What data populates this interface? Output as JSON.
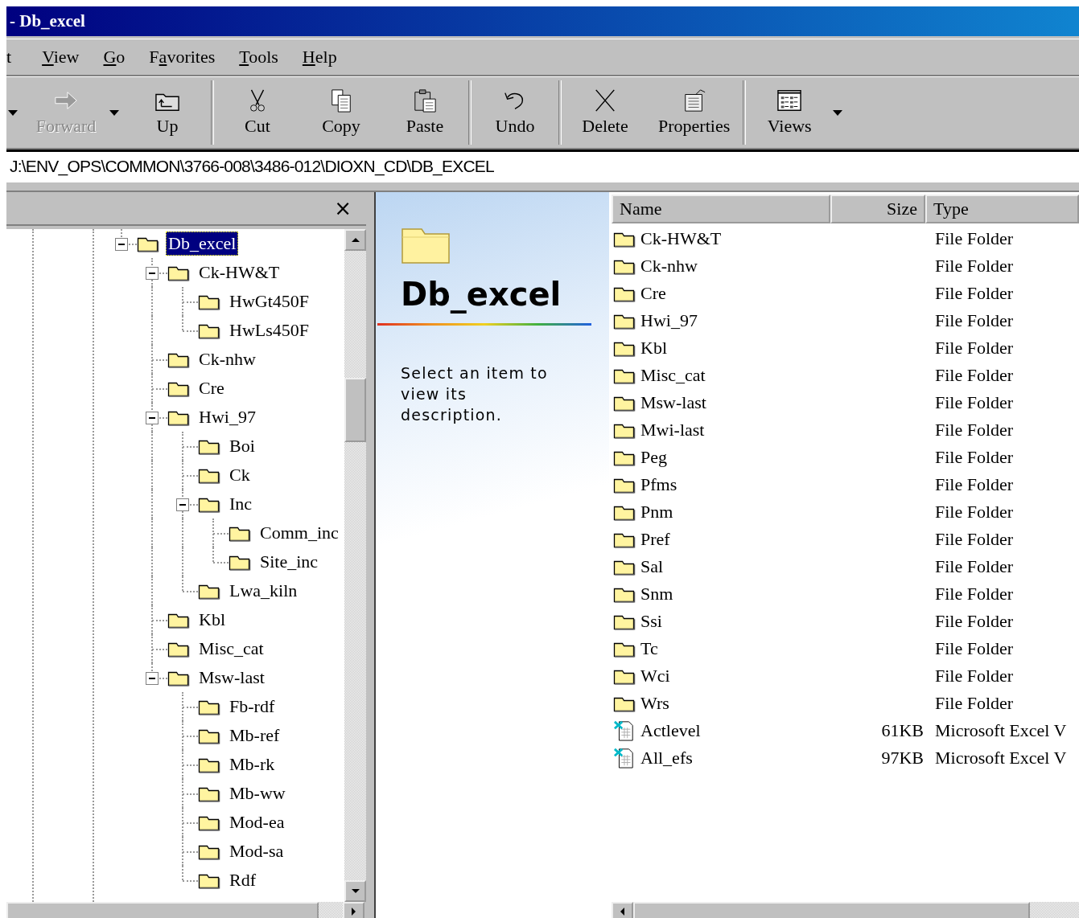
{
  "window": {
    "title": "- Db_excel"
  },
  "menu": [
    {
      "tail": "t"
    },
    {
      "key": "V",
      "tail": "iew"
    },
    {
      "key": "G",
      "tail": "o"
    },
    {
      "lead": "F",
      "key": "a",
      "tail": "vorites"
    },
    {
      "key": "T",
      "tail": "ools"
    },
    {
      "key": "H",
      "tail": "elp"
    }
  ],
  "toolbar": {
    "groups": [
      {
        "items": [
          {
            "kind": "arrow"
          },
          {
            "kind": "button",
            "label": "Forward",
            "disabled": true
          },
          {
            "kind": "arrow"
          },
          {
            "kind": "button",
            "label": "Up",
            "disabled": false
          }
        ]
      },
      {
        "items": [
          {
            "kind": "button",
            "label": "Cut",
            "disabled": false
          },
          {
            "kind": "button",
            "label": "Copy",
            "disabled": false
          },
          {
            "kind": "button",
            "label": "Paste",
            "disabled": false
          }
        ]
      },
      {
        "items": [
          {
            "kind": "button",
            "label": "Undo",
            "disabled": false
          }
        ]
      },
      {
        "items": [
          {
            "kind": "button",
            "label": "Delete",
            "disabled": false
          },
          {
            "kind": "button",
            "label": "Properties",
            "disabled": false
          }
        ]
      },
      {
        "items": [
          {
            "kind": "button",
            "label": "Views",
            "disabled": false
          },
          {
            "kind": "arrow"
          }
        ]
      }
    ]
  },
  "address": "J:\\ENV_OPS\\COMMON\\3766-008\\3486-012\\DIOXN_CD\\DB_EXCEL",
  "tree": {
    "close": "×",
    "nodes": [
      {
        "label": "Db_excel",
        "selected": true,
        "expanded": true,
        "children": [
          {
            "label": "Ck-HW&T",
            "selected": false,
            "expanded": true,
            "children": [
              {
                "label": "HwGt450F",
                "selected": false
              },
              {
                "label": "HwLs450F",
                "selected": false
              }
            ]
          },
          {
            "label": "Ck-nhw",
            "selected": false
          },
          {
            "label": "Cre",
            "selected": false
          },
          {
            "label": "Hwi_97",
            "selected": false,
            "expanded": true,
            "children": [
              {
                "label": "Boi",
                "selected": false
              },
              {
                "label": "Ck",
                "selected": false
              },
              {
                "label": "Inc",
                "selected": false,
                "expanded": true,
                "children": [
                  {
                    "label": "Comm_inc",
                    "selected": false
                  },
                  {
                    "label": "Site_inc",
                    "selected": false
                  }
                ]
              },
              {
                "label": "Lwa_kiln",
                "selected": false
              }
            ]
          },
          {
            "label": "Kbl",
            "selected": false
          },
          {
            "label": "Misc_cat",
            "selected": false
          },
          {
            "label": "Msw-last",
            "selected": false,
            "expanded": true,
            "children": [
              {
                "label": "Fb-rdf",
                "selected": false
              },
              {
                "label": "Mb-ref",
                "selected": false
              },
              {
                "label": "Mb-rk",
                "selected": false
              },
              {
                "label": "Mb-ww",
                "selected": false
              },
              {
                "label": "Mod-ea",
                "selected": false
              },
              {
                "label": "Mod-sa",
                "selected": false
              },
              {
                "label": "Rdf",
                "selected": false
              }
            ]
          }
        ]
      }
    ]
  },
  "webview": {
    "title": "Db_excel",
    "description": "Select an item to view its description."
  },
  "list": {
    "columns": [
      {
        "label": "Name"
      },
      {
        "label": "Size"
      },
      {
        "label": "Type"
      }
    ],
    "rows": [
      {
        "kind": "folder",
        "name": "Ck-HW&T",
        "type": "File Folder",
        "selected": false
      },
      {
        "kind": "folder",
        "name": "Ck-nhw",
        "type": "File Folder",
        "selected": false
      },
      {
        "kind": "folder",
        "name": "Cre",
        "type": "File Folder",
        "selected": false
      },
      {
        "kind": "folder",
        "name": "Hwi_97",
        "type": "File Folder",
        "selected": false
      },
      {
        "kind": "folder",
        "name": "Kbl",
        "type": "File Folder",
        "selected": false
      },
      {
        "kind": "folder",
        "name": "Misc_cat",
        "type": "File Folder",
        "selected": false
      },
      {
        "kind": "folder",
        "name": "Msw-last",
        "type": "File Folder",
        "selected": false
      },
      {
        "kind": "folder",
        "name": "Mwi-last",
        "type": "File Folder",
        "selected": false
      },
      {
        "kind": "folder",
        "name": "Peg",
        "type": "File Folder",
        "selected": false
      },
      {
        "kind": "folder",
        "name": "Pfms",
        "type": "File Folder",
        "selected": false
      },
      {
        "kind": "folder",
        "name": "Pnm",
        "type": "File Folder",
        "selected": false
      },
      {
        "kind": "folder",
        "name": "Pref",
        "type": "File Folder",
        "selected": false
      },
      {
        "kind": "folder",
        "name": "Sal",
        "type": "File Folder",
        "selected": false
      },
      {
        "kind": "folder",
        "name": "Snm",
        "type": "File Folder",
        "selected": false
      },
      {
        "kind": "folder",
        "name": "Ssi",
        "type": "File Folder",
        "selected": false
      },
      {
        "kind": "folder",
        "name": "Tc",
        "type": "File Folder",
        "selected": false
      },
      {
        "kind": "folder",
        "name": "Wci",
        "type": "File Folder",
        "selected": false
      },
      {
        "kind": "folder",
        "name": "Wrs",
        "type": "File Folder",
        "selected": false
      },
      {
        "kind": "excel",
        "name": "Actlevel",
        "size": "61KB",
        "type": "Microsoft Excel V",
        "selected": false
      },
      {
        "kind": "excel",
        "name": "All_efs",
        "size": "97KB",
        "type": "Microsoft Excel V",
        "selected": false
      }
    ]
  }
}
